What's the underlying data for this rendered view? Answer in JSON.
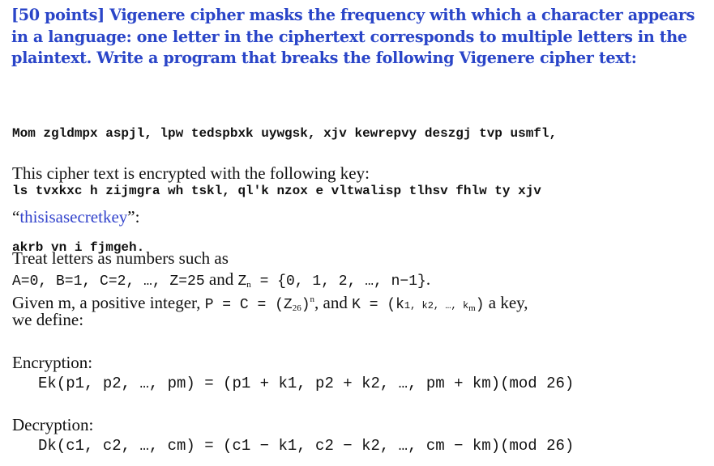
{
  "heading": {
    "lines": [
      "[50 points] Vigenere cipher masks the frequency with which a character appears",
      "in a language: one letter in the ciphertext corresponds to multiple letters in the",
      "plaintext. Write a program that breaks the following Vigenere cipher text:"
    ]
  },
  "ciphertext": {
    "lines": [
      "Mom zgldmpx aspjl, lpw tedspbxk uywgsk, xjv kewrepvy deszgj tvp usmfl,",
      "ls tvxkxc h zijmgra wh tskl, ql'k nzox e vltwalisp tlhsv fhlw ty xjv",
      "akrb vn i fjmgeh."
    ]
  },
  "key_intro": "This cipher text is encrypted with the following key:",
  "key": {
    "open_quote": "“",
    "value": "thisisasecretkey",
    "close": "”:"
  },
  "definitions": {
    "line1": "Treat letters as numbers such as",
    "line2_mono_a": "A=0,  B=1,  C=2,  …,  Z=25",
    "line2_text": " and ",
    "line2_zn": "Z",
    "line2_zn_sub": "n",
    "line2_set": " =  {0,  1,  2,  …,  n−1}",
    "line2_end": ".",
    "line3_text": "Given m, a positive integer, ",
    "line3_pc": "P  =  C  =  (Z",
    "line3_sub26": "26",
    "line3_close": ")",
    "line3_supn": "n",
    "line3_and": ", and ",
    "line3_k": "K  =  (k",
    "line3_k_rest": "1,  k",
    "line3_k_rest2": "2,  …,  k",
    "line3_k_end": ")",
    "line3_tail": " a key,",
    "line4": "we define:"
  },
  "encryption": {
    "label": "Encryption:",
    "formula": "Ek(p1, p2, …, pm) = (p1 + k1, p2 + k2, …, pm + km)(mod 26)"
  },
  "decryption": {
    "label": "Decryption:",
    "formula": "Dk(c1, c2, …, cm) = (c1 − k1, c2 − k2, …, cm − km)(mod 26)"
  }
}
